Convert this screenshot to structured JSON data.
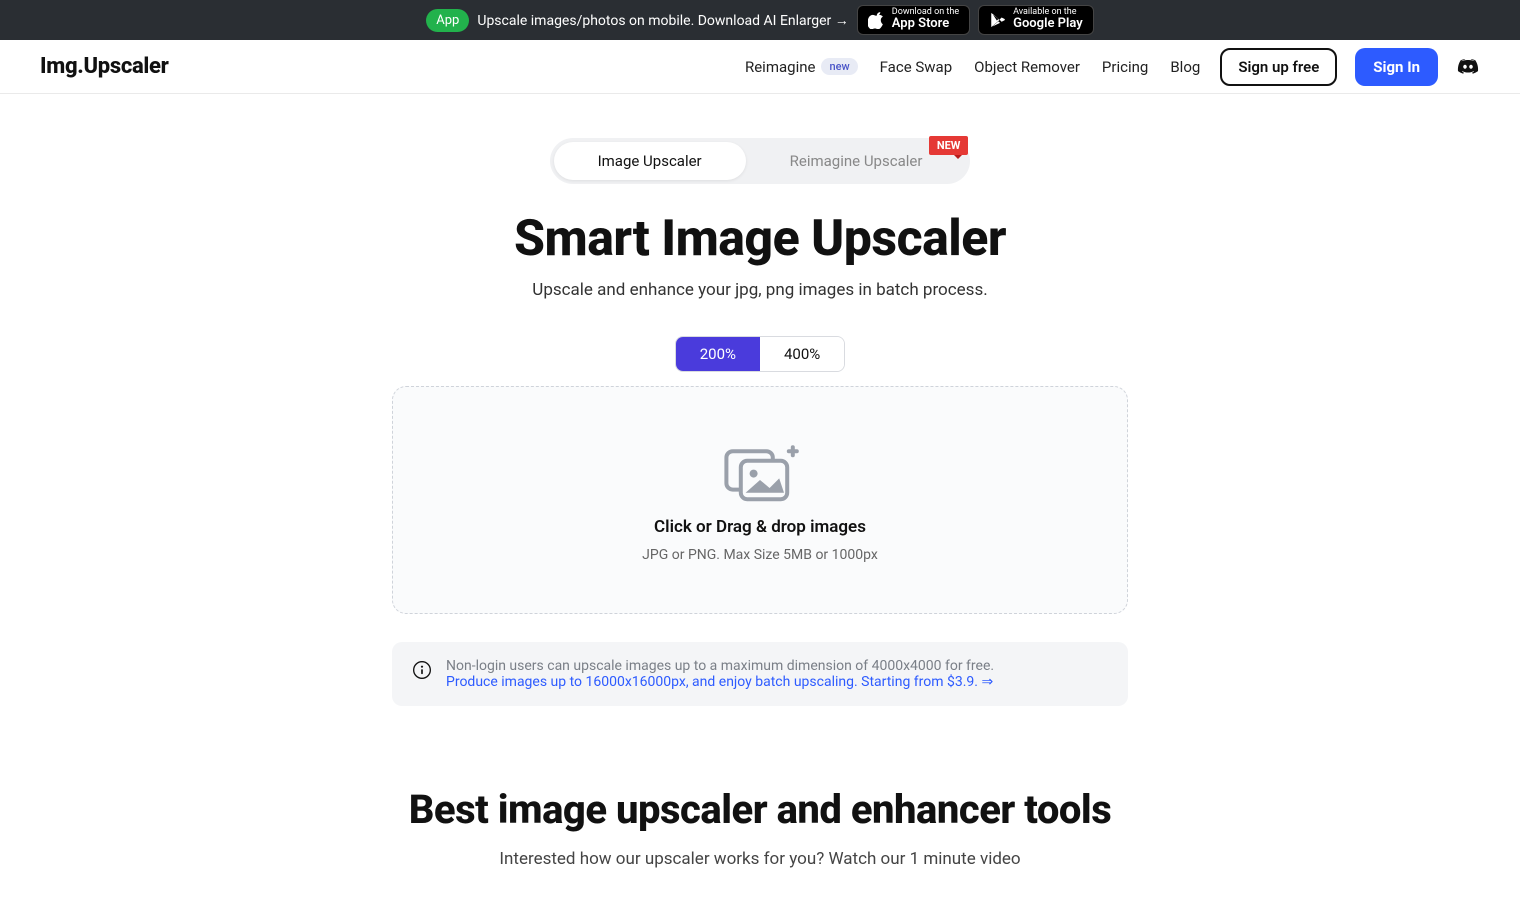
{
  "promo": {
    "app_badge": "App",
    "text": "Upscale images/photos on mobile. Download AI Enlarger →",
    "appstore_small": "Download on the",
    "appstore_large": "App Store",
    "gplay_small": "Available on the",
    "gplay_large": "Google Play"
  },
  "logo": {
    "prefix": "Img.",
    "suffix": "Upscaler"
  },
  "nav": {
    "reimagine": "Reimagine",
    "reimagine_badge": "new",
    "faceswap": "Face Swap",
    "objectremover": "Object Remover",
    "pricing": "Pricing",
    "blog": "Blog",
    "signup": "Sign up free",
    "signin": "Sign In"
  },
  "tabs": {
    "image_upscaler": "Image Upscaler",
    "reimagine_upscaler": "Reimagine Upscaler",
    "new_label": "NEW"
  },
  "hero": {
    "title": "Smart Image Upscaler",
    "subtitle": "Upscale and enhance your jpg, png images in batch process."
  },
  "scale": {
    "opt200": "200%",
    "opt400": "400%"
  },
  "dropzone": {
    "title": "Click or Drag & drop images",
    "subtitle": "JPG or PNG. Max Size 5MB or 1000px"
  },
  "info": {
    "line1": "Non-login users can upscale images up to a maximum dimension of 4000x4000 for free.",
    "line2": "Produce images up to 16000x16000px, and enjoy batch upscaling. Starting from $3.9. ⇒"
  },
  "section2": {
    "title": "Best image upscaler and enhancer tools",
    "subtitle": "Interested how our upscaler works for you? Watch our 1 minute video"
  }
}
